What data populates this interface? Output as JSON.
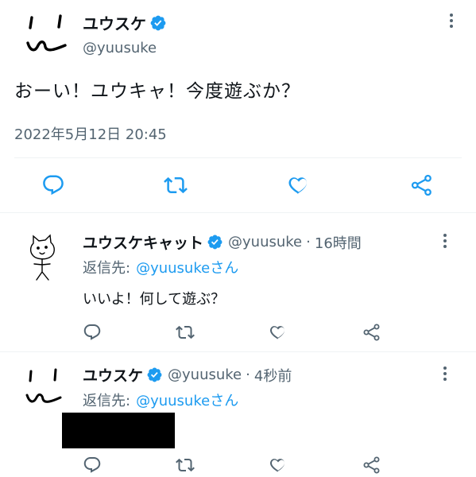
{
  "main_tweet": {
    "author_name": "ユウスケ",
    "handle": "@yuusuke",
    "text": "おーい！ユウキャ！今度遊ぶか？",
    "timestamp": "2022年5月12日 20:45"
  },
  "replies": [
    {
      "author_name": "ユウスケキャット",
      "handle": "@yuusuke",
      "separator": "·",
      "time": "16時間",
      "reply_prefix": "返信先:",
      "reply_to": "@yuusukeさん",
      "text": "いいよ！何して遊ぶ？"
    },
    {
      "author_name": "ユウスケ",
      "handle": "@yuusuke",
      "separator": "·",
      "time": "4秒前",
      "reply_prefix": "返信先:",
      "reply_to": "@yuusukeさん",
      "text_redacted": true
    }
  ],
  "icons": {
    "verified": "verified-badge-icon",
    "reply": "reply-icon",
    "retweet": "retweet-icon",
    "like": "heart-icon",
    "share": "share-icon",
    "more": "more-icon"
  },
  "colors": {
    "verified": "#1d9bf0",
    "link": "#1d9bf0",
    "muted": "#536471",
    "action_icon": "#536471",
    "main_action_icon": "#1d9bf0",
    "redaction": "#000000"
  }
}
